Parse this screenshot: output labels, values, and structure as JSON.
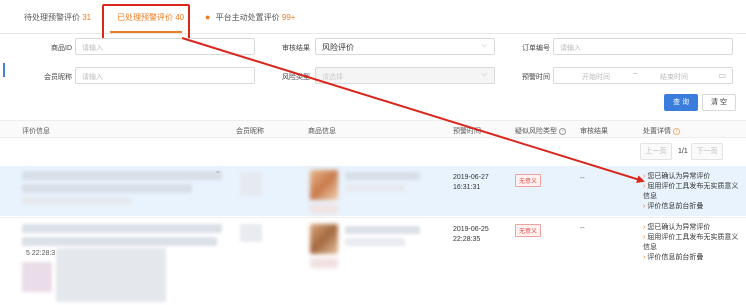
{
  "tabs": [
    {
      "label": "待处理预警评价",
      "count": "31"
    },
    {
      "label": "已处理预警评价",
      "count": "40"
    },
    {
      "label": "平台主动处置评价",
      "count": "99+"
    }
  ],
  "filters": {
    "product_id": {
      "label": "商品ID",
      "placeholder": "请输入"
    },
    "review_result": {
      "label": "审核结果",
      "value": "风险评价"
    },
    "order_no": {
      "label": "订单编号",
      "placeholder": "请输入"
    },
    "member_nick": {
      "label": "会员昵称",
      "placeholder": "请输入"
    },
    "risk_type": {
      "label": "风险类型",
      "placeholder": "请选择"
    },
    "warn_time": {
      "label": "预警时间",
      "start_placeholder": "开始时间",
      "range_sep": "~",
      "end_placeholder": "结束时间"
    }
  },
  "actions": {
    "search": "查 询",
    "clear": "清 空"
  },
  "table": {
    "headers": [
      "评价信息",
      "会员昵称",
      "商品信息",
      "预警时间",
      "疑似风险类型",
      "审核结果",
      "处置详情"
    ],
    "pager": {
      "prev": "上一页",
      "page": "1/1",
      "next": "下一页"
    },
    "rows": [
      {
        "time": [
          "2019-06-27",
          "16:31:31"
        ],
        "risk_tag": "无意义",
        "result": "--",
        "details": [
          "您已确认为异常评价",
          "屈用评价工具发布无实质意义信息",
          "评价信息前台折叠"
        ]
      },
      {
        "time": [
          "2019-06-25",
          "22:28:35"
        ],
        "risk_tag": "无意义",
        "result": "--",
        "details": [
          "您已确认为异常评价",
          "屈用评价工具发布无实质意义信息",
          "评价信息前台折叠"
        ],
        "partial_time": "5 22:28:3"
      }
    ]
  },
  "colors": {
    "accent": "#f07c22",
    "primary": "#3b7ddd",
    "annotation": "#d9271e",
    "selected_row": "#e9f3fd"
  }
}
